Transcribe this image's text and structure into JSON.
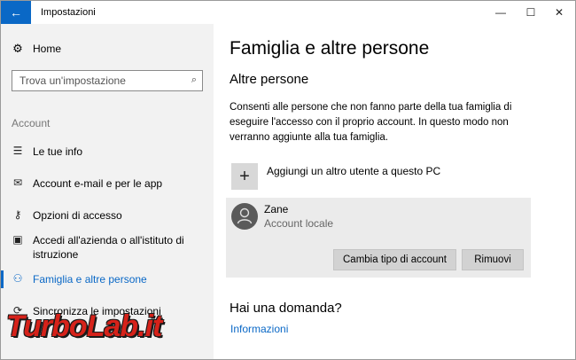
{
  "window": {
    "title": "Impostazioni",
    "back_icon": "←",
    "minimize_icon": "—",
    "maximize_icon": "☐",
    "close_icon": "✕"
  },
  "sidebar": {
    "home_label": "Home",
    "home_icon": "⚙",
    "search": {
      "placeholder": "Trova un'impostazione",
      "icon": "⌕"
    },
    "section_label": "Account",
    "items": [
      {
        "label": "Le tue info",
        "icon": "☰"
      },
      {
        "label": "Account e-mail e per le app",
        "icon": "✉"
      },
      {
        "label": "Opzioni di accesso",
        "icon": "⚷"
      },
      {
        "label": "Accedi all'azienda o all'istituto di istruzione",
        "icon": "▣"
      },
      {
        "label": "Famiglia e altre persone",
        "icon": "⚇"
      },
      {
        "label": "Sincronizza le impostazioni",
        "icon": "⟳"
      }
    ],
    "active_index": 4
  },
  "main": {
    "title": "Famiglia e altre persone",
    "section_title": "Altre persone",
    "description": "Consenti alle persone che non fanno parte della tua famiglia di eseguire l'accesso con il proprio account. In questo modo non verranno aggiunte alla tua famiglia.",
    "add_user": {
      "icon": "+",
      "label": "Aggiungi un altro utente a questo PC"
    },
    "user": {
      "name": "Zane",
      "type": "Account locale",
      "change_type_label": "Cambia tipo di account",
      "remove_label": "Rimuovi"
    },
    "question_title": "Hai una domanda?",
    "info_link": "Informazioni"
  },
  "watermark": "TurboLab.it",
  "colors": {
    "accent": "#0a68c6",
    "sidebar_bg": "#f2f2f2",
    "card_bg": "#ebebeb"
  }
}
